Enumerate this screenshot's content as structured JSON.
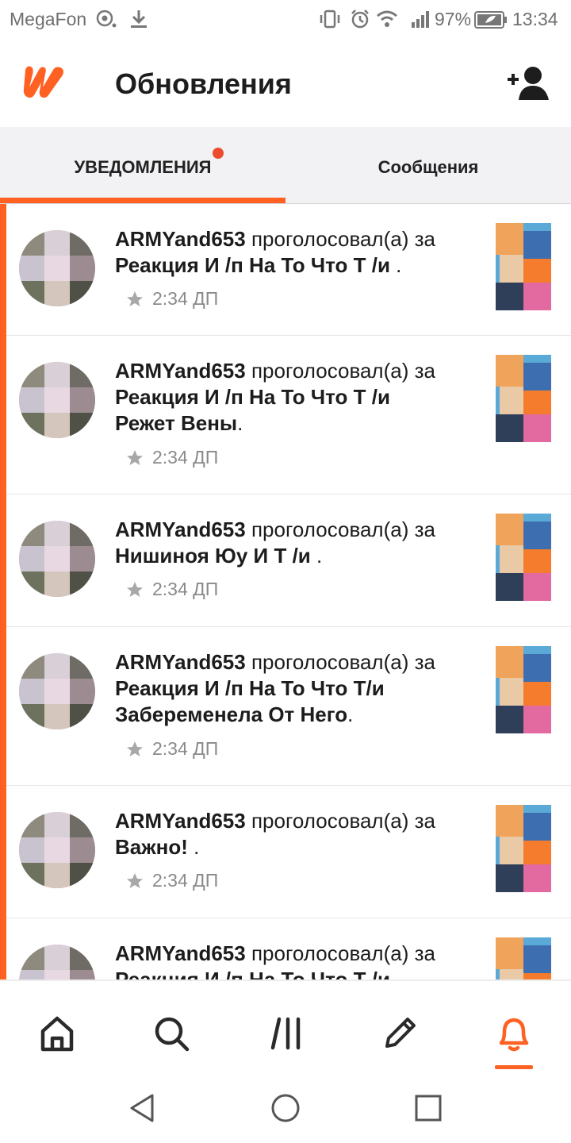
{
  "status_bar": {
    "carrier": "MegaFon",
    "battery": "97%",
    "time": "13:34"
  },
  "header": {
    "title": "Обновления"
  },
  "tabs": [
    {
      "label": "УВЕДОМЛЕНИЯ",
      "active": true,
      "has_badge": true
    },
    {
      "label": "Сообщения",
      "active": false
    }
  ],
  "notifications": [
    {
      "user": "ARMYand653",
      "action": "проголосовал(а) за",
      "story": "Реакция И /п На То Что Т /и",
      "suffix": " .",
      "time": "2:34 ДП"
    },
    {
      "user": "ARMYand653",
      "action": "проголосовал(а) за",
      "story": "Реакция И /п На То Что Т /и Режет Вены",
      "suffix": ".",
      "time": "2:34 ДП"
    },
    {
      "user": "ARMYand653",
      "action": "проголосовал(а) за",
      "story": "Нишиноя Юу И Т /и",
      "suffix": " .",
      "time": "2:34 ДП"
    },
    {
      "user": "ARMYand653",
      "action": "проголосовал(а) за",
      "story": "Реакция И /п На То Что Т/и Забеременела От Него",
      "suffix": ".",
      "time": "2:34 ДП"
    },
    {
      "user": "ARMYand653",
      "action": "проголосовал(а) за",
      "story": "Важно!",
      "suffix": " .",
      "time": "2:34 ДП"
    },
    {
      "user": "ARMYand653",
      "action": "проголосовал(а) за",
      "story": "Реакция И /п На То Что Т /и",
      "suffix": "",
      "time": ""
    }
  ],
  "bottom_nav": [
    {
      "icon": "home-icon"
    },
    {
      "icon": "search-icon"
    },
    {
      "icon": "library-icon"
    },
    {
      "icon": "write-icon"
    },
    {
      "icon": "bell-icon",
      "active": true
    }
  ],
  "colors": {
    "accent": "#ff6122",
    "badge": "#ec4c2b"
  }
}
